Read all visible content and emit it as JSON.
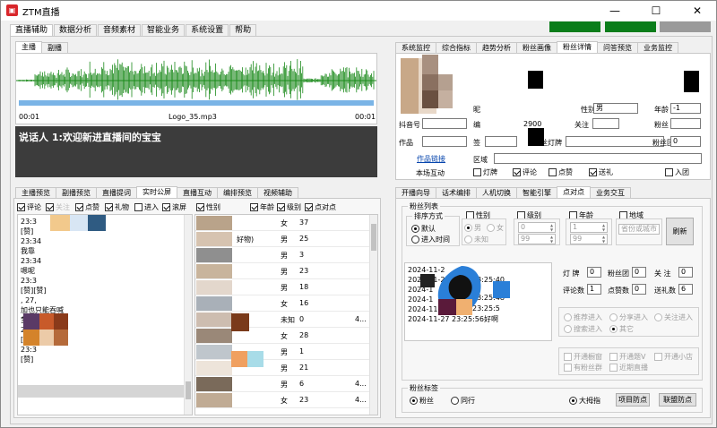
{
  "app": {
    "title": "ZTM直播",
    "icon": "app-logo-icon",
    "icon_text": "▣"
  },
  "window_controls": {
    "minimize": "—",
    "maximize": "☐",
    "close": "✕"
  },
  "menu": [
    "直播辅助",
    "数据分析",
    "音频素材",
    "智能业务",
    "系统设置",
    "帮助"
  ],
  "status_colors": {
    "green": "#0a7d1a",
    "gray": "#9a9a9a"
  },
  "player": {
    "tabs": [
      "主播",
      "副播"
    ],
    "time_start": "00:01",
    "filename": "Logo_35.mp3",
    "time_end": "00:01",
    "wave_color": "#1c8a1c",
    "subtitle": "说话人 1:欢迎新进直播间的宝宝"
  },
  "left_tabs": [
    "主播预览",
    "副播预览",
    "直播提词",
    "实时公屏",
    "直播互动",
    "编排预览",
    "视频辅助"
  ],
  "left_filters": [
    "评论",
    "点赞",
    "礼物",
    "进入",
    "滚屏",
    "性别",
    "年龄",
    "级别",
    "点对点"
  ],
  "left_filter_hidden": "关注",
  "chat_lines": [
    "23:3",
    "",
    "[赞]",
    "23:34",
    "我靠",
    "23:34",
    "嗯呢",
    "23:3",
    "[赞][赞]",
    ", 27,",
    "加也只能吞喊",
    "梦想, 21,",
    "",
    "23:3",
    "[赞][赞]",
    "23:3",
    "[赞]"
  ],
  "viewer_rows": [
    {
      "name": "",
      "gender": "女",
      "age": "37",
      "flag": ""
    },
    {
      "name": "好物)",
      "gender": "男",
      "age": "25",
      "flag": ""
    },
    {
      "name": "",
      "gender": "男",
      "age": "3",
      "flag": ""
    },
    {
      "name": "",
      "gender": "男",
      "age": "23",
      "flag": ""
    },
    {
      "name": "",
      "gender": "男",
      "age": "18",
      "flag": ""
    },
    {
      "name": "",
      "gender": "女",
      "age": "16",
      "flag": ""
    },
    {
      "name": "",
      "gender": "未知",
      "age": "0",
      "flag": "4..."
    },
    {
      "name": "",
      "gender": "女",
      "age": "28",
      "flag": ""
    },
    {
      "name": "",
      "gender": "男",
      "age": "1",
      "flag": ""
    },
    {
      "name": "",
      "gender": "男",
      "age": "21",
      "flag": ""
    },
    {
      "name": "",
      "gender": "男",
      "age": "6",
      "flag": "4..."
    },
    {
      "name": "",
      "gender": "女",
      "age": "23",
      "flag": "4..."
    }
  ],
  "right_top_tabs": [
    "系统监控",
    "综合指标",
    "趋势分析",
    "粉丝画像",
    "粉丝详情",
    "问答预览",
    "业务监控"
  ],
  "fan_detail": {
    "gender_label": "性别",
    "gender_value": "男",
    "age_label": "年龄",
    "age_value": "-1",
    "douyin_label": "抖音号",
    "num_2900": "2900",
    "follow_label": "关注",
    "fans_label": "粉丝",
    "works_label": "作品",
    "fan_light_label": "粉丝灯牌",
    "fan_group_label": "粉丝团",
    "fan_group_value": "0",
    "works_link": "作品链接",
    "region_label": "区域",
    "interact_label": "本场互动",
    "interact_items": [
      {
        "label": "灯牌",
        "checked": false
      },
      {
        "label": "评论",
        "checked": true
      },
      {
        "label": "点赞",
        "checked": false
      },
      {
        "label": "送礼",
        "checked": true
      },
      {
        "label": "入团",
        "checked": false
      }
    ]
  },
  "right_mid_tabs": [
    "开播向导",
    "话术编排",
    "人机切换",
    "智能引擎",
    "点对点",
    "业务交互"
  ],
  "fan_list": {
    "title": "粉丝列表",
    "sort_title": "排序方式",
    "sort_options": [
      "默认",
      "进入时间"
    ],
    "gender_title": "性别",
    "gender_options": [
      "男",
      "女",
      "未知"
    ],
    "level_title": "级别",
    "level_from": "0",
    "level_to": "99",
    "age_title": "年龄",
    "age_from": "1",
    "age_to": "99",
    "region_title": "地域",
    "region_placeholder": "省份或城市",
    "refresh": "刷新",
    "log_lines": [
      "2024-11-2",
      "2024-11-2",
      "2024-1",
      "2024-1",
      "2024-11-27",
      "2024-11-27 23:25:56好啊"
    ],
    "log_fragments": [
      "23:25:40",
      "23:25:48",
      "23:25:5"
    ],
    "stats": [
      {
        "label": "灯 牌",
        "value": "0"
      },
      {
        "label": "粉丝团",
        "value": "0"
      },
      {
        "label": "关 注",
        "value": "0"
      },
      {
        "label": "评论数",
        "value": "1"
      },
      {
        "label": "点赞数",
        "value": "0"
      },
      {
        "label": "送礼数",
        "value": "6"
      }
    ],
    "enter_options": [
      "推荐进入",
      "分享进入",
      "关注进入",
      "搜索进入",
      "其它"
    ],
    "extra_checks": [
      "开通橱窗",
      "开通题V",
      "开通小店",
      "有粉丝群",
      "近期直播"
    ]
  },
  "fan_tag": {
    "title": "粉丝标签",
    "options": [
      "粉丝",
      "同行"
    ],
    "big_tag": "大拇指",
    "btn1": "项目防点",
    "btn2": "联盟防点"
  }
}
